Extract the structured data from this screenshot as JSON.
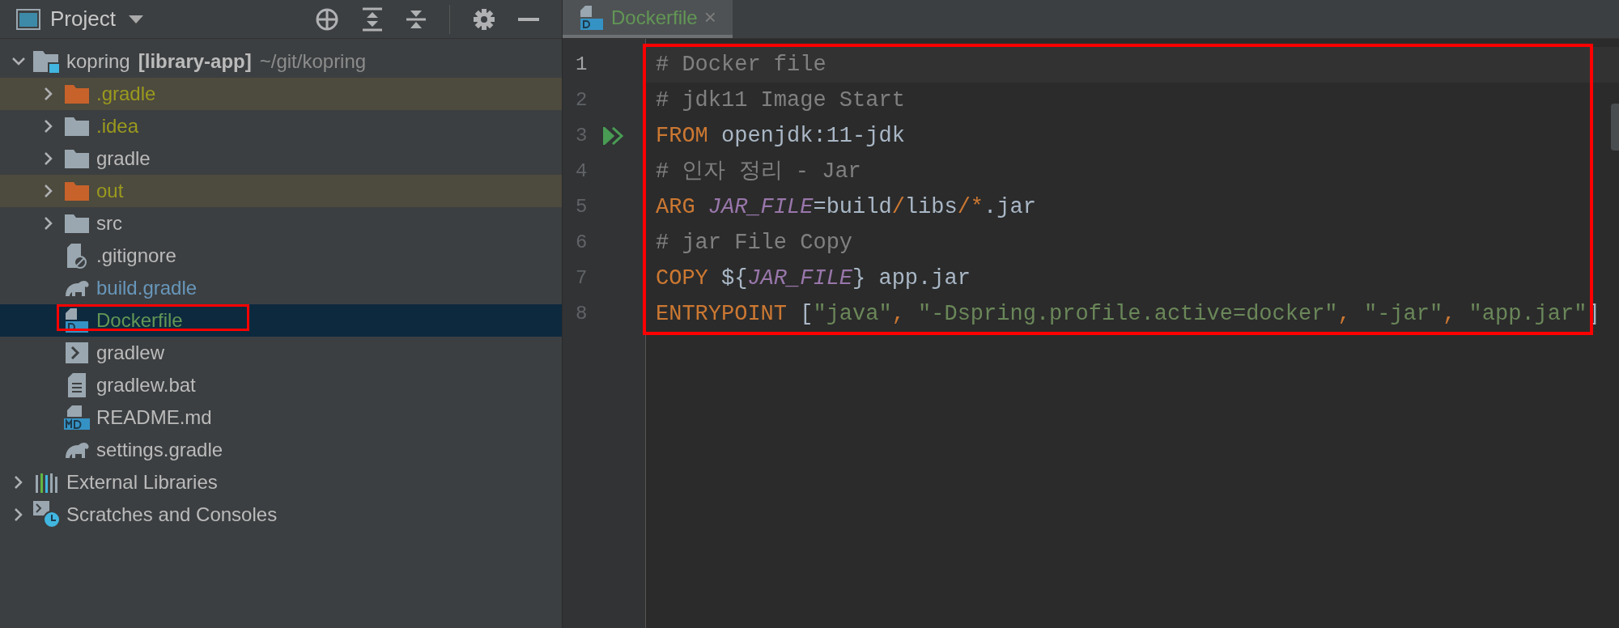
{
  "project_panel": {
    "title": "Project"
  },
  "tree": [
    {
      "label": "kopring",
      "module": "[library-app]",
      "path": "~/git/kopring",
      "kind": "module",
      "expanded": true,
      "selected": false,
      "children": [
        {
          "label": ".gradle",
          "kind": "excluded",
          "expanded": false,
          "selected": false,
          "color": "#9a9a1e"
        },
        {
          "label": ".idea",
          "kind": "folder",
          "expanded": false,
          "selected": false,
          "color": "#9a9a1e"
        },
        {
          "label": "gradle",
          "kind": "folder",
          "expanded": false,
          "selected": false
        },
        {
          "label": "out",
          "kind": "excluded",
          "expanded": false,
          "selected": false,
          "color": "#9a9a1e"
        },
        {
          "label": "src",
          "kind": "folder",
          "expanded": false,
          "selected": false
        },
        {
          "label": ".gitignore",
          "kind": "ignorefile",
          "selected": false
        },
        {
          "label": "build.gradle",
          "kind": "gradle",
          "selected": false,
          "color": "#6897bb"
        },
        {
          "label": "Dockerfile",
          "kind": "docker",
          "selected": true,
          "color": "#629755",
          "outlined": true
        },
        {
          "label": "gradlew",
          "kind": "shell",
          "selected": false
        },
        {
          "label": "gradlew.bat",
          "kind": "text",
          "selected": false
        },
        {
          "label": "README.md",
          "kind": "markdown",
          "selected": false
        },
        {
          "label": "settings.gradle",
          "kind": "gradle",
          "selected": false
        }
      ]
    },
    {
      "label": "External Libraries",
      "kind": "libraries",
      "expanded": false,
      "selected": false
    },
    {
      "label": "Scratches and Consoles",
      "kind": "scratches",
      "expanded": false,
      "selected": false
    }
  ],
  "tabs": [
    {
      "label": "Dockerfile",
      "close": "×",
      "selected": true,
      "color": "#629755"
    }
  ],
  "editor": {
    "outlined": true,
    "lines": [
      {
        "number": "1",
        "current": true,
        "tokens": [
          {
            "kind": "comment",
            "text": "# Docker file"
          }
        ]
      },
      {
        "number": "2",
        "current": false,
        "tokens": [
          {
            "kind": "comment",
            "text": "# jdk11 Image Start"
          }
        ]
      },
      {
        "number": "3",
        "current": false,
        "run": true,
        "tokens": [
          {
            "kind": "keyword",
            "text": "FROM"
          },
          {
            "kind": "plain",
            "text": " openjdk:11-jdk"
          }
        ]
      },
      {
        "number": "4",
        "current": false,
        "tokens": [
          {
            "kind": "comment",
            "text": "# 인자 정리 - Jar"
          }
        ]
      },
      {
        "number": "5",
        "current": false,
        "tokens": [
          {
            "kind": "keyword",
            "text": "ARG"
          },
          {
            "kind": "variable",
            "text": " JAR_FILE"
          },
          {
            "kind": "plain",
            "text": "=build"
          },
          {
            "kind": "punct",
            "text": "/"
          },
          {
            "kind": "plain",
            "text": "libs"
          },
          {
            "kind": "punct",
            "text": "/*"
          },
          {
            "kind": "plain",
            "text": ".jar"
          }
        ]
      },
      {
        "number": "6",
        "current": false,
        "tokens": [
          {
            "kind": "comment",
            "text": "# jar File Copy"
          }
        ]
      },
      {
        "number": "7",
        "current": false,
        "tokens": [
          {
            "kind": "keyword",
            "text": "COPY"
          },
          {
            "kind": "plain",
            "text": " ${"
          },
          {
            "kind": "variable",
            "text": "JAR_FILE"
          },
          {
            "kind": "plain",
            "text": "} app.jar"
          }
        ]
      },
      {
        "number": "8",
        "current": false,
        "tokens": [
          {
            "kind": "keyword",
            "text": "ENTRYPOINT"
          },
          {
            "kind": "plain",
            "text": " ["
          },
          {
            "kind": "string",
            "text": "\"java\""
          },
          {
            "kind": "punct",
            "text": ", "
          },
          {
            "kind": "string",
            "text": "\"-Dspring.profile.active=docker\""
          },
          {
            "kind": "punct",
            "text": ", "
          },
          {
            "kind": "string",
            "text": "\"-jar\""
          },
          {
            "kind": "punct",
            "text": ", "
          },
          {
            "kind": "string",
            "text": "\"app.jar\""
          },
          {
            "kind": "plain",
            "text": "]"
          }
        ]
      }
    ]
  }
}
